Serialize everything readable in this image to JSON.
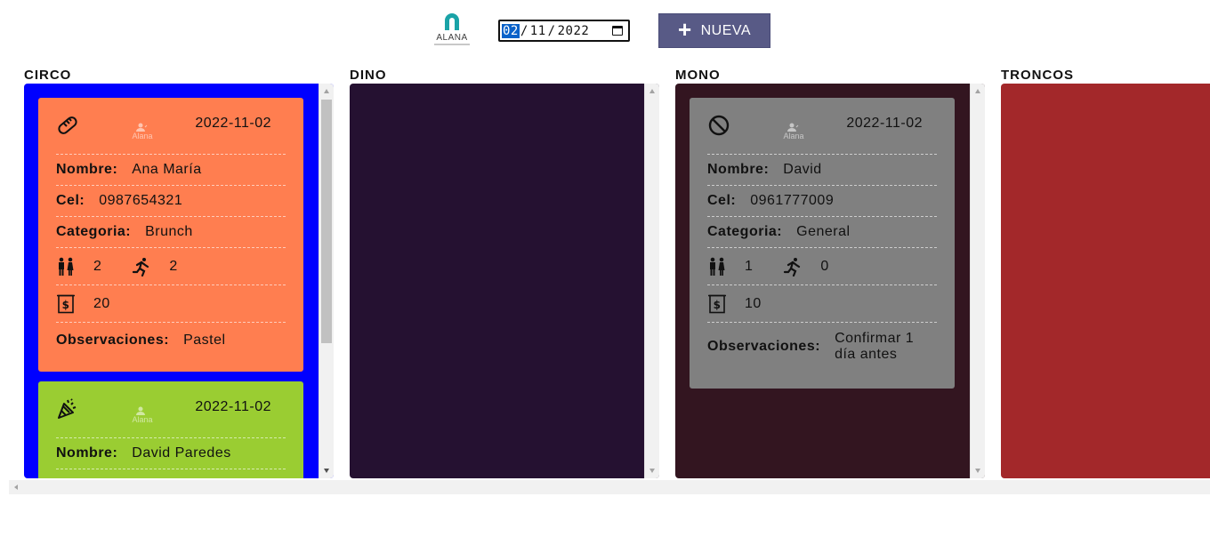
{
  "header": {
    "brand": "ALANA",
    "date": {
      "day": "02",
      "month": "11",
      "year": "2022"
    },
    "new_button": "NUEVA",
    "icons": {
      "add": "plus-icon",
      "calendar": "calendar-icon"
    }
  },
  "labels": {
    "nombre": "Nombre:",
    "cel": "Cel:",
    "categoria": "Categoria:",
    "observaciones": "Observaciones:"
  },
  "columns": [
    {
      "title": "CIRCO",
      "color": "#0000ff"
    },
    {
      "title": "DINO",
      "color": "#251131"
    },
    {
      "title": "MONO",
      "color": "#331520"
    },
    {
      "title": "TRONCOS",
      "color": "#a3282a"
    }
  ],
  "cards": [
    {
      "column": "CIRCO",
      "color": "#ff7e50",
      "icon": "bread-icon",
      "user": "Alana",
      "date": "2022-11-02",
      "nombre": "Ana María",
      "cel": "0987654321",
      "categoria": "Brunch",
      "adults": "2",
      "children": "2",
      "amount": "20",
      "observaciones": "Pastel"
    },
    {
      "column": "CIRCO",
      "color": "#9acd32",
      "icon": "party-popper-icon",
      "user": "Alana",
      "date": "2022-11-02",
      "nombre": "David Paredes"
    },
    {
      "column": "MONO",
      "color": "#808080",
      "icon": "prohibited-icon",
      "user": "Alana",
      "date": "2022-11-02",
      "nombre": "David",
      "cel": "0961777009",
      "categoria": "General",
      "adults": "1",
      "children": "0",
      "amount": "10",
      "observaciones": "Confirmar 1 día antes"
    }
  ]
}
